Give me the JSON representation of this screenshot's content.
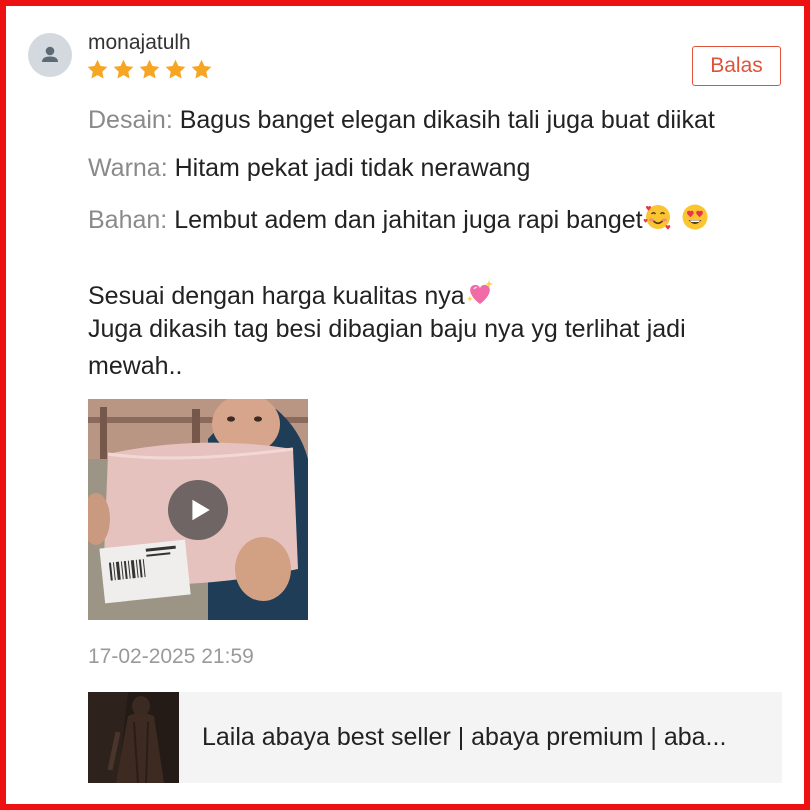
{
  "review": {
    "username": "monajatulh",
    "rating": 5,
    "reply_label": "Balas",
    "attributes": [
      {
        "key": "Desain:",
        "value": " Bagus banget elegan dikasih tali juga buat diikat"
      },
      {
        "key": "Warna:",
        "value": " Hitam pekat jadi tidak nerawang"
      },
      {
        "key": "Bahan:",
        "value": " Lembut adem dan jahitan juga rapi banget"
      }
    ],
    "body": {
      "line1": "Sesuai dengan harga kualitas nya",
      "line2": "Juga dikasih tag besi dibagian baju nya yg terlihat jadi",
      "line3": "mewah.."
    },
    "timestamp": "17-02-2025 21:59"
  },
  "product": {
    "title": "Laila abaya best seller | abaya premium | aba..."
  },
  "icons": {
    "avatar": "user-icon",
    "star": "star-icon",
    "play": "play-icon",
    "emoji_1": "smiling-face-with-hearts-icon",
    "emoji_2": "heart-eyes-icon",
    "emoji_3": "sparkling-heart-icon"
  },
  "colors": {
    "accent": "#e0533b",
    "star": "#f7a623",
    "frame": "#ee1111",
    "label_gray": "#8a8a8a"
  }
}
